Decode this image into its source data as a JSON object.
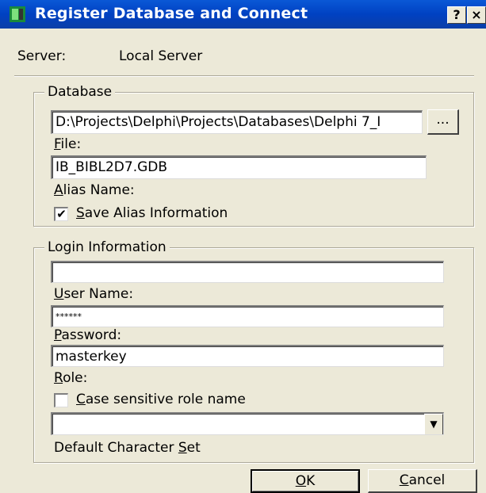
{
  "window": {
    "title": "Register Database and Connect",
    "help_button": "?",
    "close_button": "×"
  },
  "server": {
    "label": "Server:",
    "value": "Local Server"
  },
  "database_group": {
    "legend": "Database",
    "path_value": "D:\\Projects\\Delphi\\Projects\\Databases\\Delphi 7_I",
    "browse_button": "...",
    "file_label_mnemonic": "F",
    "file_label_rest": "ile:",
    "file_value": "IB_BIBL2D7.GDB",
    "alias_label_mnemonic": "A",
    "alias_label_rest": "lias Name:",
    "save_alias_checked": true,
    "save_alias_mnemonic": "S",
    "save_alias_rest": "ave Alias Information"
  },
  "login_group": {
    "legend": "Login Information",
    "top_field_value": "",
    "username_label_mnemonic": "U",
    "username_label_rest": "ser Name:",
    "username_value": "******",
    "password_label_mnemonic": "P",
    "password_label_rest": "assword:",
    "password_value": "masterkey",
    "role_label_mnemonic": "R",
    "role_label_rest": "ole:",
    "case_sensitive_checked": false,
    "case_sensitive_mnemonic": "C",
    "case_sensitive_rest": "ase sensitive role name",
    "role_combo_value": "",
    "charset_label_prefix": "Default Character ",
    "charset_label_mnemonic": "S",
    "charset_label_rest": "et"
  },
  "buttons": {
    "ok_mnemonic": "O",
    "ok_rest": "K",
    "cancel_mnemonic": "C",
    "cancel_rest": "ancel"
  },
  "colors": {
    "titlebar": "#0a58d6",
    "dialog_bg": "#ece9d8"
  },
  "icons": {
    "app": "database-app-icon",
    "checkmark": "✔",
    "dropdown": "▼"
  }
}
